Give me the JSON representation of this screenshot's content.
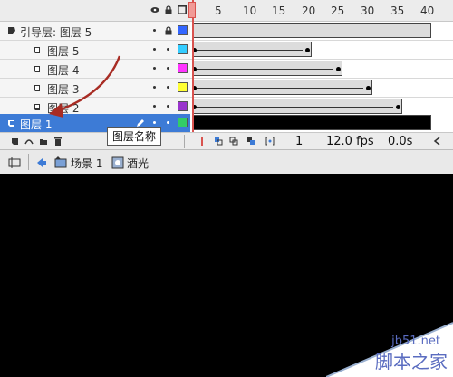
{
  "ruler": {
    "ticks": [
      "5",
      "10",
      "15",
      "20",
      "25",
      "30",
      "35",
      "40"
    ]
  },
  "layers": [
    {
      "name": "引导层: 图层 5",
      "color": "#3366ff",
      "selected": false,
      "guide": true
    },
    {
      "name": "图层 5",
      "color": "#33ccff",
      "selected": false
    },
    {
      "name": "图层 4",
      "color": "#ff33ff",
      "selected": false
    },
    {
      "name": "图层 3",
      "color": "#ffff33",
      "selected": false
    },
    {
      "name": "图层 2",
      "color": "#9933cc",
      "selected": false
    },
    {
      "name": "图层 1",
      "color": "#33cc66",
      "selected": true
    }
  ],
  "tooltip": {
    "text": "图层名称"
  },
  "bottom_bar": {
    "current_frame": "1",
    "fps": "12.0 fps",
    "time": "0.0s"
  },
  "edit_bar": {
    "scene_label": "场景 1",
    "symbol_label": "酒光"
  },
  "watermark": {
    "site": "jb51.net",
    "name": "脚本之家"
  },
  "colors": {
    "selection": "#3d7bd6",
    "playhead": "#d9534f",
    "annotation_arrow": "#a82c24"
  }
}
